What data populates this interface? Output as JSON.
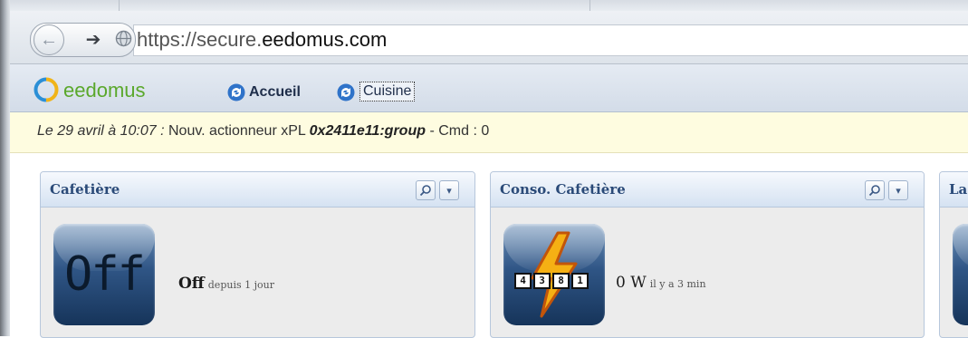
{
  "browser": {
    "url_prefix": "https://secure.",
    "url_domain": "eedomus.com"
  },
  "app": {
    "logo_text": "eedomus",
    "breadcrumb": [
      {
        "label": "Accueil"
      },
      {
        "label": "Cuisine"
      }
    ]
  },
  "notification": {
    "date": "Le 29 avril à 10:07 :",
    "message": " Nouv. actionneur xPL ",
    "device": "0x2411e11:group",
    "suffix": " - Cmd : 0"
  },
  "widgets": [
    {
      "title": "Cafetière",
      "tile_label": "Off",
      "value": "Off",
      "since": "depuis 1 jour"
    },
    {
      "title": "Conso. Cafetière",
      "counter_digits": [
        "4",
        "3",
        "8",
        "1"
      ],
      "value": "0 W",
      "since": "il y a 3 min"
    },
    {
      "title": "La"
    }
  ],
  "icons": {
    "back": "arrow-left-icon",
    "forward": "arrow-right-icon",
    "site": "globe-icon",
    "breadcrumb": "refresh-arrows-icon",
    "search": "magnifier-icon",
    "menu": "chevron-down-icon",
    "power": "lightning-bolt-icon"
  },
  "colors": {
    "logo": "#5aa82b",
    "widget_title": "#2a4a78",
    "notification_bg": "#fefce0"
  }
}
